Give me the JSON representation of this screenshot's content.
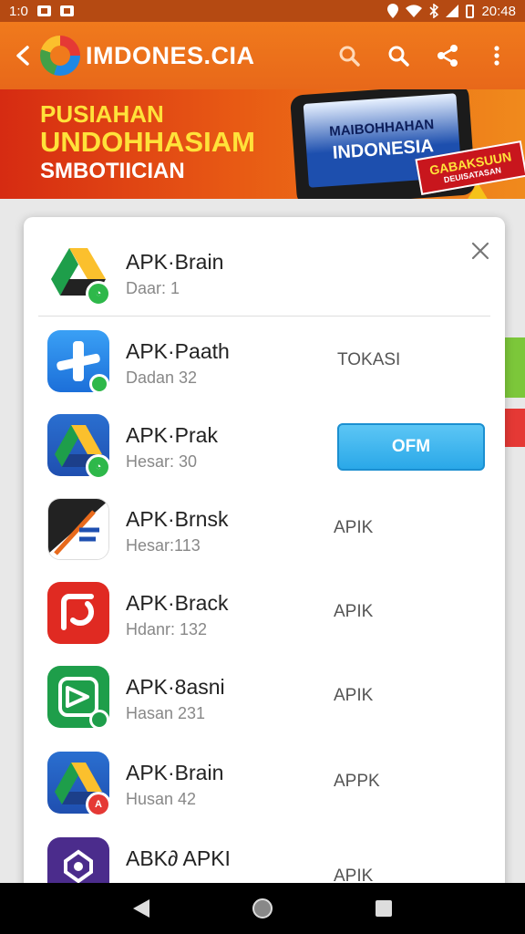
{
  "status_bar": {
    "time_left": "1:0",
    "time_right": "20:48"
  },
  "app_bar": {
    "title": "IMDONES.CIA"
  },
  "banner": {
    "line1": "PUSIAHAN",
    "line2": "UNDOHHASIAM",
    "line3": "SMBOTIICIAN",
    "tablet_line1": "MAIBOHHAHAN",
    "tablet_line2": "INDONESIA",
    "stamp_text": "GABAKSUUN",
    "stamp_sub": "DEUISATASAN"
  },
  "dialog": {
    "header_app": {
      "name": "APK·Brain",
      "subtitle": "Daar: 1"
    },
    "rows": [
      {
        "name": "APK·Paath",
        "subtitle": "Dadan 32",
        "action": "TOKASI"
      },
      {
        "name": "APK·Prak",
        "subtitle": "Hesar: 30",
        "action": "OFM"
      },
      {
        "name": "APK·Brnsk",
        "subtitle": "Hesar:113",
        "action": "APIK"
      },
      {
        "name": "APK·Brack",
        "subtitle": "Hdanr: 132",
        "action": "APIK"
      },
      {
        "name": "APK·8asni",
        "subtitle": "Hasan 231",
        "action": "APIK"
      },
      {
        "name": "APK·Brain",
        "subtitle": "Husan 42",
        "action": "APPK"
      },
      {
        "name": "ABK∂ APKI",
        "subtitle": "",
        "action": "APIK"
      }
    ]
  },
  "colors": {
    "accent": "#f07a1c",
    "button": "#2aa8e8"
  }
}
